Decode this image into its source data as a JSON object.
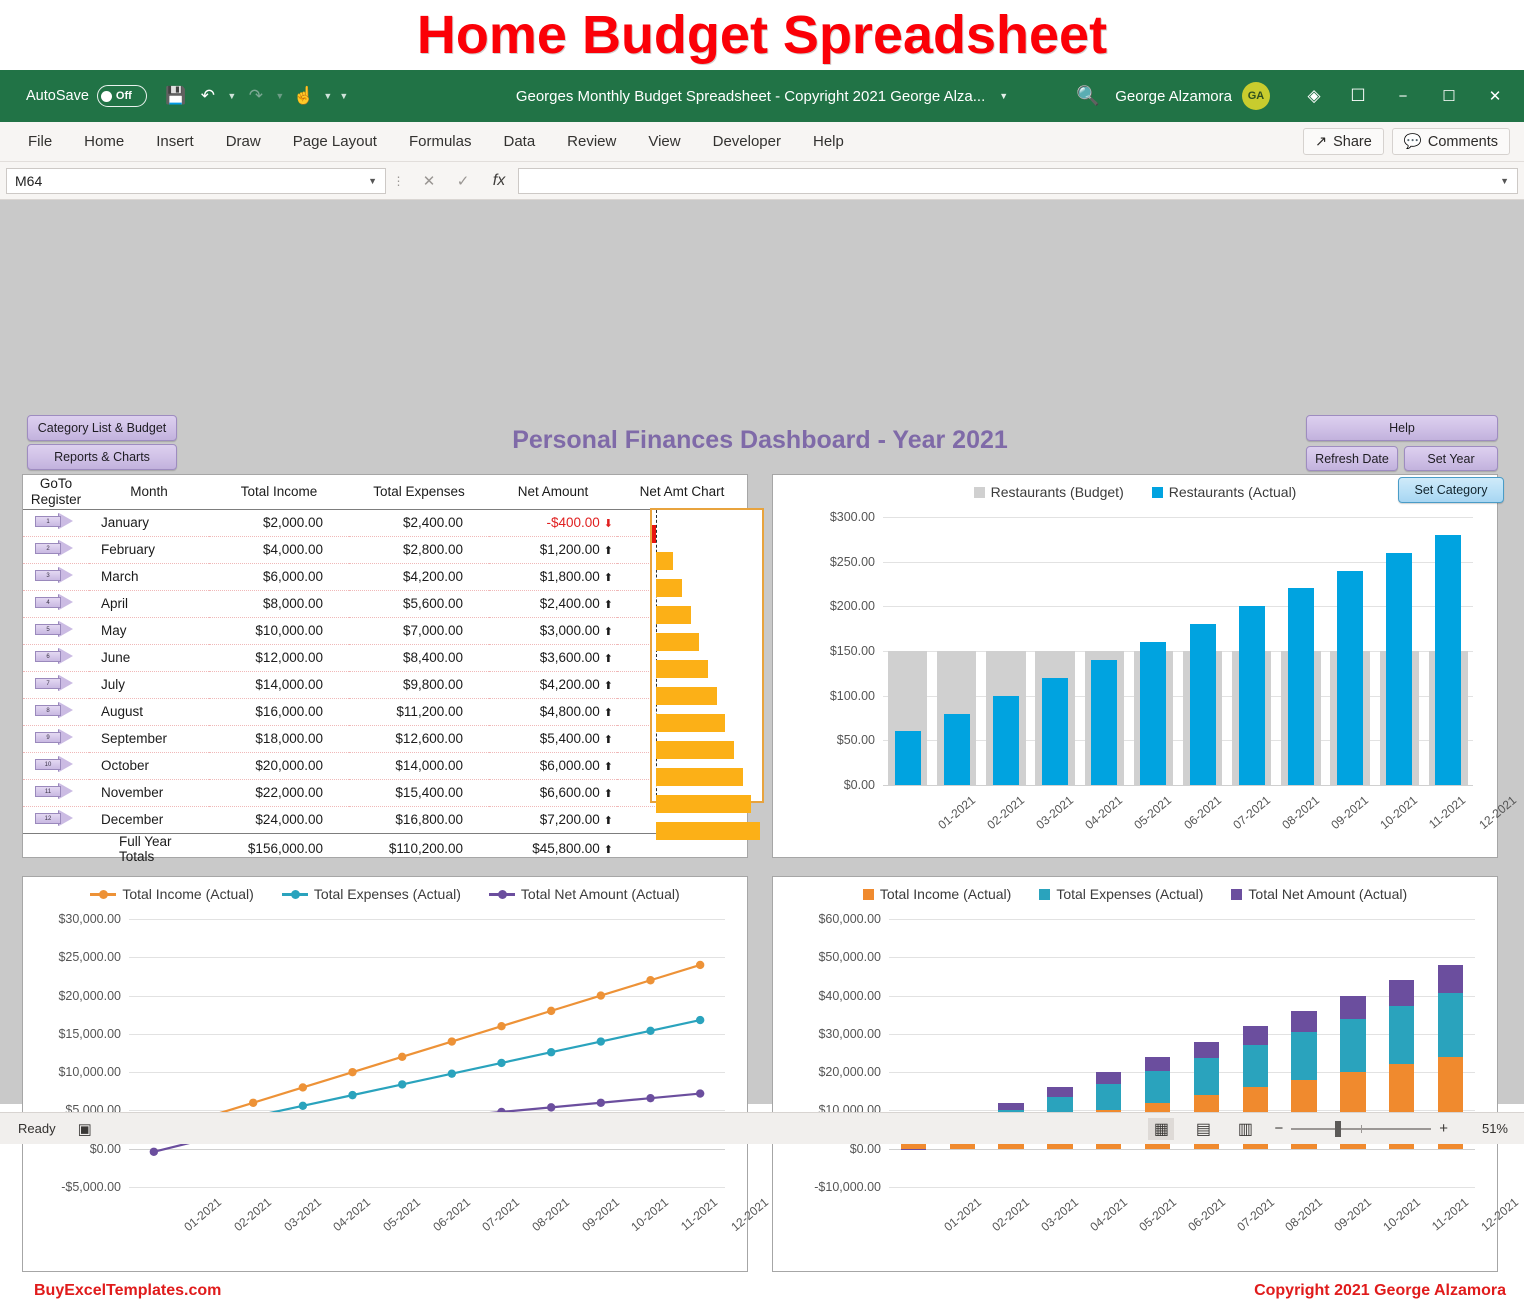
{
  "banner": {
    "title": "Home Budget Spreadsheet"
  },
  "titlebar": {
    "autosave_label": "AutoSave",
    "autosave_state": "Off",
    "document_title": "Georges Monthly Budget Spreadsheet - Copyright 2021 George Alza...",
    "user_name": "George Alzamora",
    "avatar_initials": "GA",
    "icons": [
      "save-icon",
      "undo-icon",
      "redo-icon",
      "touch-mode-icon",
      "customize-qat-icon",
      "search-icon",
      "diamond-icon",
      "ribbon-display-icon",
      "minimize-icon",
      "maximize-icon",
      "close-icon"
    ]
  },
  "ribbon": {
    "tabs": [
      "File",
      "Home",
      "Insert",
      "Draw",
      "Page Layout",
      "Formulas",
      "Data",
      "Review",
      "View",
      "Developer",
      "Help"
    ],
    "share_label": "Share",
    "comments_label": "Comments"
  },
  "formulabar": {
    "namebox_value": "M64",
    "formula_value": "",
    "cancel_icon": "close-icon",
    "enter_icon": "check-icon",
    "fx_label": "fx"
  },
  "dashboard": {
    "title": "Personal Finances Dashboard - Year 2021",
    "buttons": {
      "category_list": "Category List & Budget",
      "reports_charts": "Reports & Charts",
      "help": "Help",
      "refresh_date": "Refresh Date",
      "set_year": "Set Year",
      "set_category": "Set Category"
    }
  },
  "table": {
    "headers": [
      "GoTo Register",
      "Month",
      "Total Income",
      "Total Expenses",
      "Net Amount",
      "Net Amt Chart"
    ],
    "header_goto_line1": "GoTo",
    "header_goto_line2": "Register",
    "rows": [
      {
        "n": "1",
        "month": "January",
        "income": "$2,000.00",
        "expenses": "$2,400.00",
        "net": "-$400.00",
        "dir": "down"
      },
      {
        "n": "2",
        "month": "February",
        "income": "$4,000.00",
        "expenses": "$2,800.00",
        "net": "$1,200.00",
        "dir": "up"
      },
      {
        "n": "3",
        "month": "March",
        "income": "$6,000.00",
        "expenses": "$4,200.00",
        "net": "$1,800.00",
        "dir": "up"
      },
      {
        "n": "4",
        "month": "April",
        "income": "$8,000.00",
        "expenses": "$5,600.00",
        "net": "$2,400.00",
        "dir": "up"
      },
      {
        "n": "5",
        "month": "May",
        "income": "$10,000.00",
        "expenses": "$7,000.00",
        "net": "$3,000.00",
        "dir": "up"
      },
      {
        "n": "6",
        "month": "June",
        "income": "$12,000.00",
        "expenses": "$8,400.00",
        "net": "$3,600.00",
        "dir": "up"
      },
      {
        "n": "7",
        "month": "July",
        "income": "$14,000.00",
        "expenses": "$9,800.00",
        "net": "$4,200.00",
        "dir": "up"
      },
      {
        "n": "8",
        "month": "August",
        "income": "$16,000.00",
        "expenses": "$11,200.00",
        "net": "$4,800.00",
        "dir": "up"
      },
      {
        "n": "9",
        "month": "September",
        "income": "$18,000.00",
        "expenses": "$12,600.00",
        "net": "$5,400.00",
        "dir": "up"
      },
      {
        "n": "10",
        "month": "October",
        "income": "$20,000.00",
        "expenses": "$14,000.00",
        "net": "$6,000.00",
        "dir": "up"
      },
      {
        "n": "11",
        "month": "November",
        "income": "$22,000.00",
        "expenses": "$15,400.00",
        "net": "$6,600.00",
        "dir": "up"
      },
      {
        "n": "12",
        "month": "December",
        "income": "$24,000.00",
        "expenses": "$16,800.00",
        "net": "$7,200.00",
        "dir": "up"
      }
    ],
    "totals": {
      "label": "Full Year Totals",
      "income": "$156,000.00",
      "expenses": "$110,200.00",
      "net": "$45,800.00",
      "dir": "up"
    }
  },
  "chart_data": [
    {
      "id": "restaurants",
      "type": "bar",
      "title": "",
      "categories": [
        "01-2021",
        "02-2021",
        "03-2021",
        "04-2021",
        "05-2021",
        "06-2021",
        "07-2021",
        "08-2021",
        "09-2021",
        "10-2021",
        "11-2021",
        "12-2021"
      ],
      "series": [
        {
          "name": "Restaurants (Budget)",
          "color": "#d0d0d0",
          "values": [
            150,
            150,
            150,
            150,
            150,
            150,
            150,
            150,
            150,
            150,
            150,
            150
          ]
        },
        {
          "name": "Restaurants (Actual)",
          "color": "#00a3e0",
          "values": [
            60,
            80,
            100,
            120,
            140,
            160,
            180,
            200,
            220,
            240,
            260,
            280
          ]
        }
      ],
      "ylim": [
        0,
        300
      ],
      "yticks": [
        "$0.00",
        "$50.00",
        "$100.00",
        "$150.00",
        "$200.00",
        "$250.00",
        "$300.00"
      ],
      "ytick_values": [
        0,
        50,
        100,
        150,
        200,
        250,
        300
      ],
      "xlabel": "",
      "ylabel": "",
      "grid": true,
      "legend_position": "top",
      "overlap": true
    },
    {
      "id": "totals-lines",
      "type": "line",
      "title": "",
      "categories": [
        "01-2021",
        "02-2021",
        "03-2021",
        "04-2021",
        "05-2021",
        "06-2021",
        "07-2021",
        "08-2021",
        "09-2021",
        "10-2021",
        "11-2021",
        "12-2021"
      ],
      "series": [
        {
          "name": "Total Income (Actual)",
          "color": "#ed9237",
          "values": [
            2000,
            4000,
            6000,
            8000,
            10000,
            12000,
            14000,
            16000,
            18000,
            20000,
            22000,
            24000
          ]
        },
        {
          "name": "Total Expenses (Actual)",
          "color": "#2aa3bd",
          "values": [
            2400,
            2800,
            4200,
            5600,
            7000,
            8400,
            9800,
            11200,
            12600,
            14000,
            15400,
            16800
          ]
        },
        {
          "name": "Total Net Amount (Actual)",
          "color": "#6b4e9e",
          "values": [
            -400,
            1200,
            1800,
            2400,
            3000,
            3600,
            4200,
            4800,
            5400,
            6000,
            6600,
            7200
          ]
        }
      ],
      "ylim": [
        -5000,
        30000
      ],
      "yticks": [
        "-$5,000.00",
        "$0.00",
        "$5,000.00",
        "$10,000.00",
        "$15,000.00",
        "$20,000.00",
        "$25,000.00",
        "$30,000.00"
      ],
      "ytick_values": [
        -5000,
        0,
        5000,
        10000,
        15000,
        20000,
        25000,
        30000
      ],
      "xlabel": "",
      "ylabel": "",
      "grid": true,
      "legend_position": "top"
    },
    {
      "id": "totals-stacked",
      "type": "bar",
      "stacked": true,
      "title": "",
      "categories": [
        "01-2021",
        "02-2021",
        "03-2021",
        "04-2021",
        "05-2021",
        "06-2021",
        "07-2021",
        "08-2021",
        "09-2021",
        "10-2021",
        "11-2021",
        "12-2021"
      ],
      "series": [
        {
          "name": "Total Income (Actual)",
          "color": "#f08a2e",
          "values": [
            2000,
            4000,
            6000,
            8000,
            10000,
            12000,
            14000,
            16000,
            18000,
            20000,
            22000,
            24000
          ]
        },
        {
          "name": "Total Expenses (Actual)",
          "color": "#2aa3bd",
          "values": [
            2400,
            2800,
            4200,
            5600,
            7000,
            8400,
            9800,
            11200,
            12600,
            14000,
            15400,
            16800
          ]
        },
        {
          "name": "Total Net Amount (Actual)",
          "color": "#6b4e9e",
          "values": [
            -400,
            1200,
            1800,
            2400,
            3000,
            3600,
            4200,
            4800,
            5400,
            6000,
            6600,
            7200
          ]
        }
      ],
      "ylim": [
        -10000,
        60000
      ],
      "yticks": [
        "-$10,000.00",
        "$0.00",
        "$10,000.00",
        "$20,000.00",
        "$30,000.00",
        "$40,000.00",
        "$50,000.00",
        "$60,000.00"
      ],
      "ytick_values": [
        -10000,
        0,
        10000,
        20000,
        30000,
        40000,
        50000,
        60000
      ],
      "xlabel": "",
      "ylabel": "",
      "grid": true,
      "legend_position": "top"
    }
  ],
  "footer": {
    "brand": "BuyExcelTemplates.com",
    "copyright": "Copyright 2021  George Alzamora"
  },
  "statusbar": {
    "status": "Ready",
    "zoom": "51%",
    "view_icons": [
      "normal-view-icon",
      "page-layout-icon",
      "page-break-preview-icon"
    ]
  }
}
